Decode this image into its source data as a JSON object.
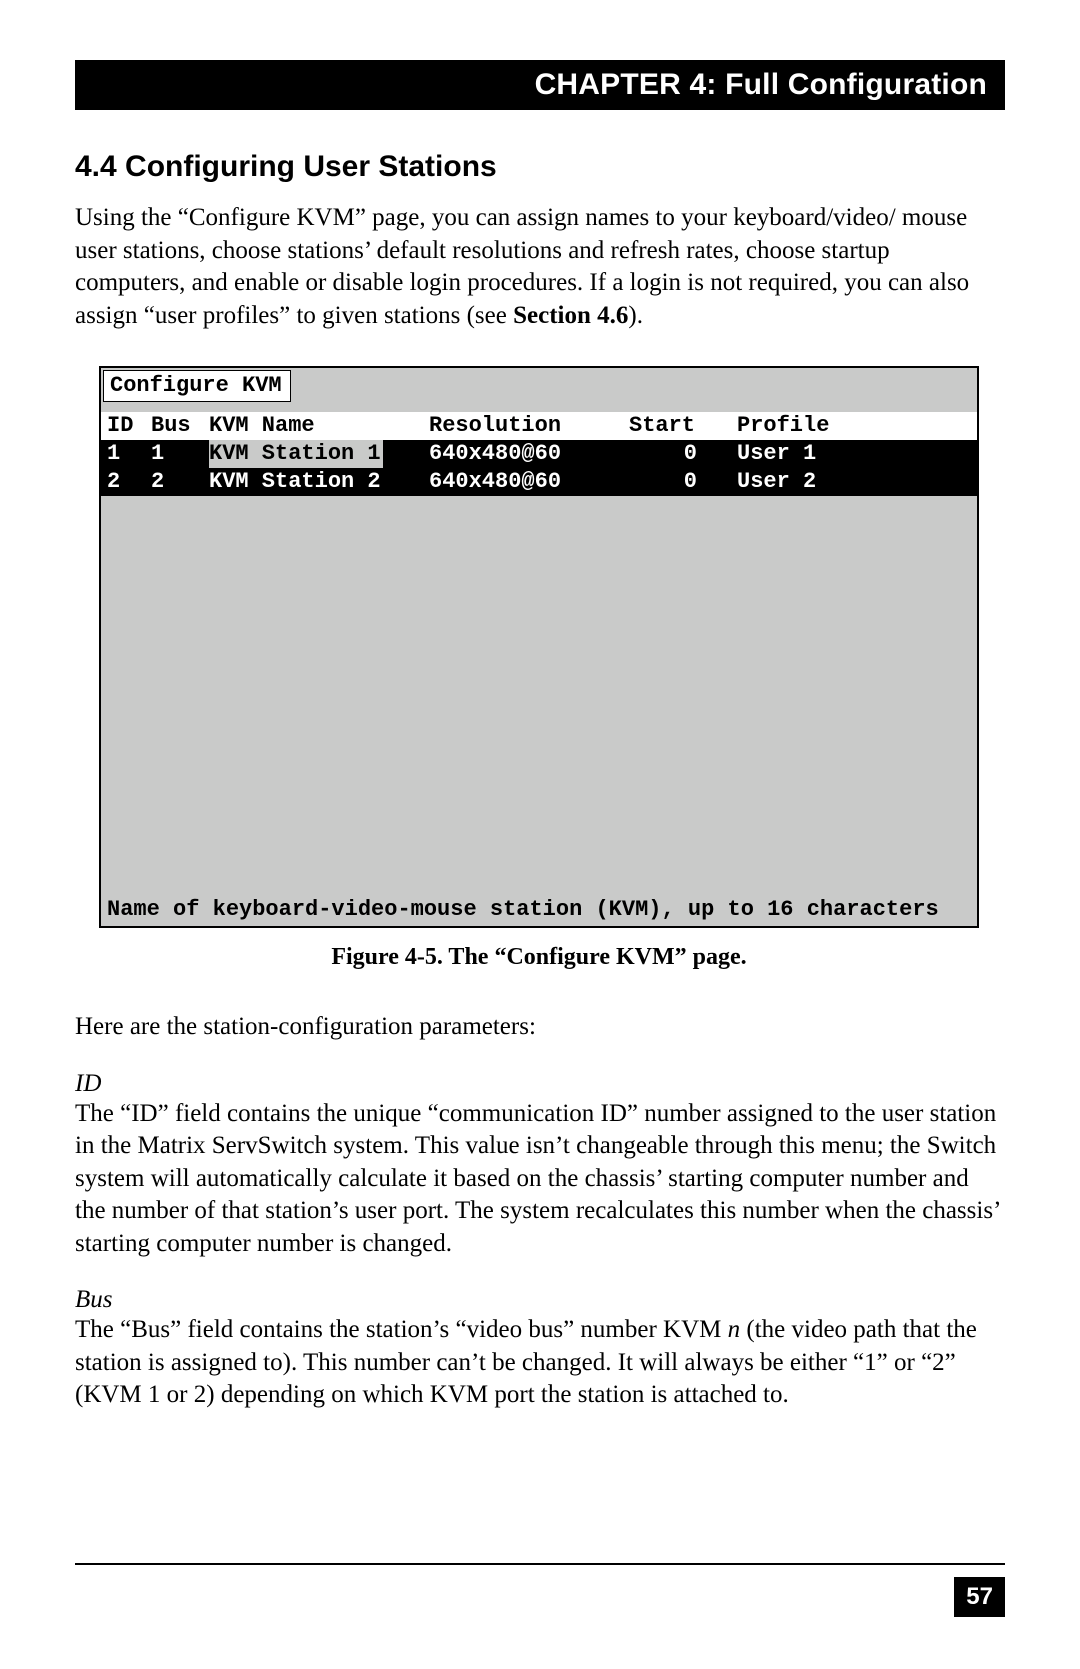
{
  "chapter_bar": "CHAPTER 4: Full Configuration",
  "section_title": "4.4 Configuring User Stations",
  "intro_html": "Using the “Configure KVM” page, you can assign names to your keyboard/video/ mouse user stations, choose stations’ default resolutions and refresh rates, choose startup computers, and enable or disable login procedures. If a login is not required, you can also assign “user profiles” to given stations (see <b>Section 4.6</b>).",
  "terminal": {
    "title": "Configure KVM",
    "headers": {
      "id": "ID",
      "bus": "Bus",
      "name": "KVM Name",
      "resolution": "Resolution",
      "start": "Start",
      "profile": "Profile"
    },
    "rows": [
      {
        "id": "1",
        "bus": "1",
        "name": "KVM Station  1",
        "resolution": "640x480@60",
        "start": "0",
        "profile": "User 1",
        "name_highlighted": true
      },
      {
        "id": "2",
        "bus": "2",
        "name": "KVM Station  2",
        "resolution": "640x480@60",
        "start": "0",
        "profile": "User 2",
        "name_highlighted": false
      }
    ],
    "footer": "Name of keyboard-video-mouse station (KVM), up to 16 characters"
  },
  "figure_caption": "Figure 4-5. The “Configure KVM” page.",
  "params_intro": "Here are the station-configuration parameters:",
  "param_id": {
    "label": "ID",
    "text": "The “ID” field contains the unique “communication ID” number assigned to the user station in the Matrix ServSwitch system. This value isn’t changeable through this menu; the Switch system will automatically calculate it based on the chassis’ starting computer number and the number of that station’s user port. The system recalculates this number when the chassis’ starting computer number is changed."
  },
  "param_bus": {
    "label": "Bus",
    "text_html": "The “Bus” field contains the station’s “video bus” number KVM <span class=\"italic-n\">n</span> (the video path that the station is assigned to). This number can’t be changed. It will always be either “1” or “2” (KVM 1 or 2) depending on which KVM port the station is attached to."
  },
  "page_number": "57"
}
